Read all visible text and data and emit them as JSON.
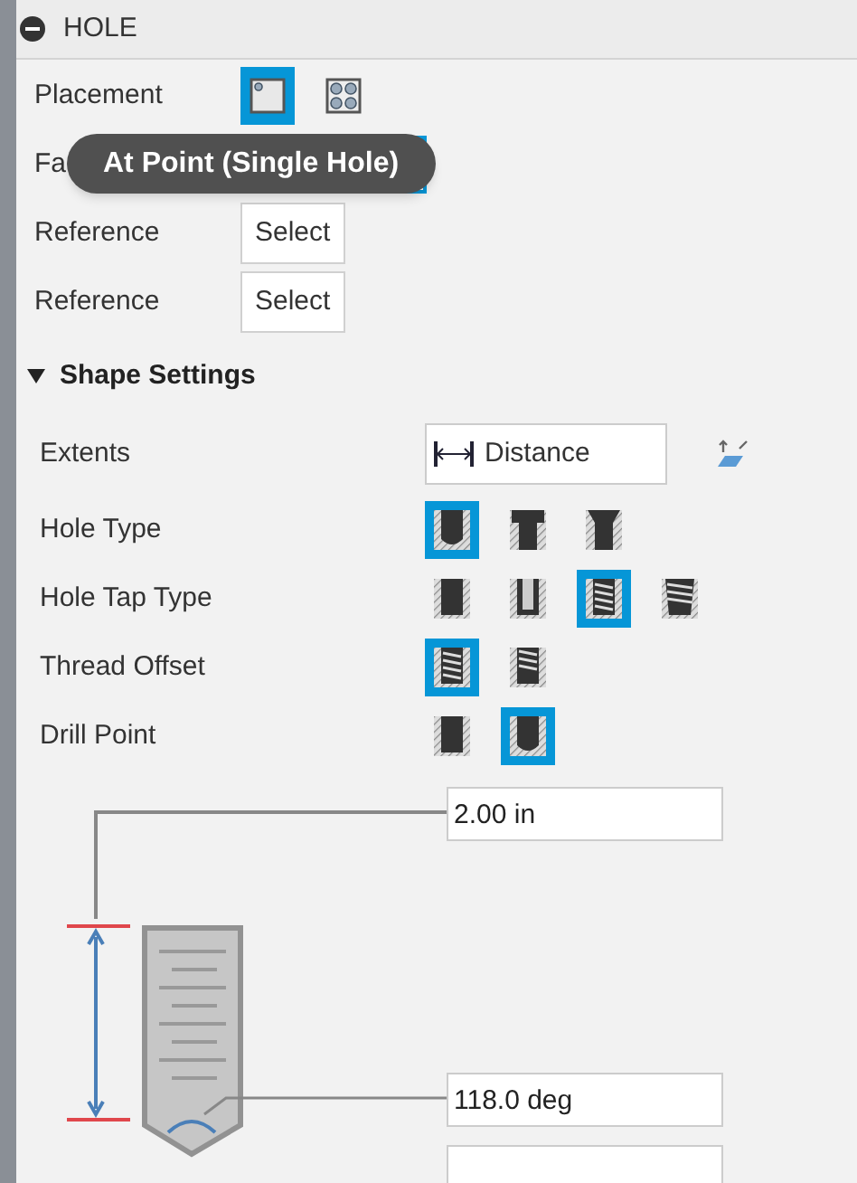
{
  "panel": {
    "title": "HOLE",
    "expanded": true
  },
  "top_rows": [
    {
      "kind": "icon_options",
      "label": "Placement",
      "options": [
        {
          "kind": "single",
          "selected": true
        },
        {
          "kind": "pattern",
          "selected": false
        }
      ]
    },
    {
      "kind": "selection",
      "label": "Fa",
      "active": true
    },
    {
      "kind": "select",
      "label": "Reference",
      "button": "Select"
    },
    {
      "kind": "select",
      "label": "Reference",
      "button": "Select"
    }
  ],
  "tooltip": {
    "text": "At Point (Single Hole)"
  },
  "section": {
    "title": "Shape Settings",
    "expanded": true,
    "rows": [
      {
        "kind": "dropdown",
        "label": "Extents",
        "value": "Distance"
      },
      {
        "kind": "icon_options",
        "label": "Hole Type",
        "options": [
          {
            "kind": "simple",
            "selected": true
          },
          {
            "kind": "counterbore",
            "selected": false
          },
          {
            "kind": "countersink",
            "selected": false
          }
        ]
      },
      {
        "kind": "icon_options",
        "label": "Hole Tap Type",
        "options": [
          {
            "kind": "solid",
            "selected": false
          },
          {
            "kind": "clearance",
            "selected": false
          },
          {
            "kind": "tapped",
            "selected": true
          },
          {
            "kind": "taper",
            "selected": false
          }
        ]
      },
      {
        "kind": "icon_options",
        "label": "Thread Offset",
        "options": [
          {
            "kind": "tapped",
            "selected": true
          },
          {
            "kind": "partial",
            "selected": false
          }
        ]
      },
      {
        "kind": "icon_options",
        "label": "Drill Point",
        "options": [
          {
            "kind": "solid",
            "selected": false
          },
          {
            "kind": "simple",
            "selected": true
          }
        ]
      }
    ]
  },
  "diagram": {
    "fields": [
      {
        "value": "2.00 in"
      },
      {
        "value": "118.0 deg"
      }
    ]
  }
}
